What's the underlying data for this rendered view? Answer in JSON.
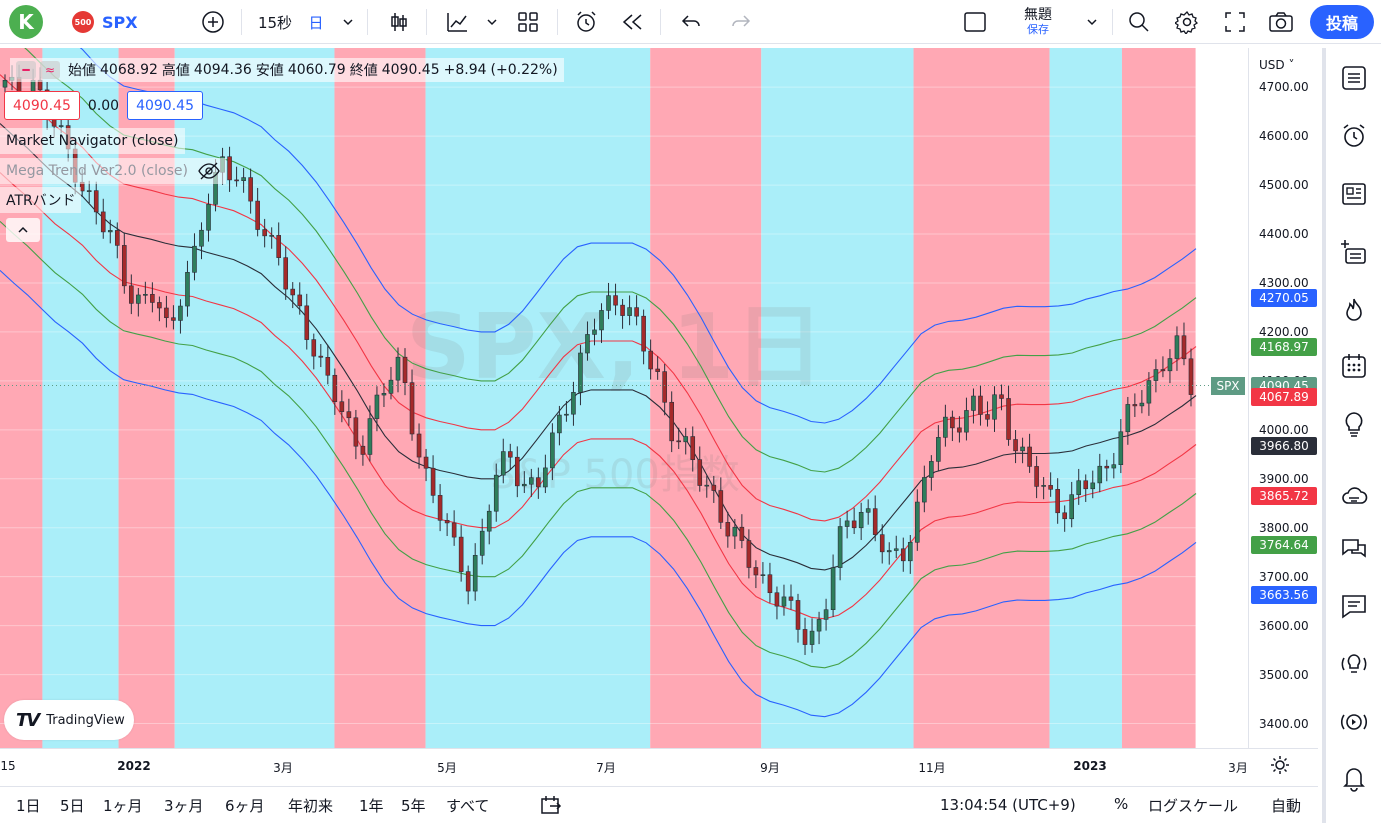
{
  "header": {
    "avatar_letter": "K",
    "symbol_badge": "500",
    "symbol": "SPX",
    "interval": "15秒",
    "chart_style_label": "日",
    "layout_name": "無題",
    "layout_save": "保存",
    "publish": "投稿"
  },
  "legend": {
    "open_label": "始値",
    "open": "4068.92",
    "high_label": "高値",
    "high": "4094.36",
    "low_label": "安値",
    "low": "4060.79",
    "close_label": "終値",
    "close": "4090.45",
    "change": "+8.94",
    "change_pct": "(+0.22%)"
  },
  "readout": {
    "bid": "4090.45",
    "spread": "0.00",
    "ask": "4090.45"
  },
  "indicators": {
    "ind1": "Market Navigator (close)",
    "ind2": "Mega Trend Ver2.0 (close)",
    "ind3": "ATRバンド"
  },
  "watermark": {
    "symbol": "SPX, 1日",
    "name": "S&P 500指数"
  },
  "logo": "TradingView",
  "price_axis": {
    "currency": "USD",
    "ticks": [
      "4700.00",
      "4600.00",
      "4500.00",
      "4400.00",
      "4300.00",
      "4200.00",
      "4100.00",
      "4000.00",
      "3900.00",
      "3800.00",
      "3700.00",
      "3600.00",
      "3500.00",
      "3400.00"
    ],
    "labels": [
      {
        "text": "4270.05",
        "color": "#2962ff",
        "value": 4270.05
      },
      {
        "text": "4168.97",
        "color": "#43a047",
        "value": 4168.97
      },
      {
        "text": "4090.45",
        "color": "#5e9b84",
        "value": 4090.45
      },
      {
        "text": "4067.89",
        "color": "#f23645",
        "value": 4067.89
      },
      {
        "text": "3966.80",
        "color": "#2a2e39",
        "value": 3966.8
      },
      {
        "text": "3865.72",
        "color": "#f23645",
        "value": 3865.72
      },
      {
        "text": "3764.64",
        "color": "#43a047",
        "value": 3764.64
      },
      {
        "text": "3663.56",
        "color": "#2962ff",
        "value": 3663.56
      }
    ],
    "symbol_tag": "SPX"
  },
  "time_axis": [
    "15",
    "2022",
    "3月",
    "5月",
    "7月",
    "9月",
    "11月",
    "2023",
    "3月"
  ],
  "bottom": {
    "ranges": [
      "1日",
      "5日",
      "1ヶ月",
      "3ヶ月",
      "6ヶ月",
      "年初来",
      "1年",
      "5年",
      "すべて"
    ],
    "clock": "13:04:54 (UTC+9)",
    "percent": "%",
    "log": "ログスケール",
    "auto": "自動"
  },
  "chart_data": {
    "type": "candlestick",
    "ylim": [
      3350,
      4780
    ],
    "background_zones": [
      {
        "from": 0.0,
        "to": 0.034,
        "color": "#ffa8b4"
      },
      {
        "from": 0.034,
        "to": 0.095,
        "color": "#aaeef9"
      },
      {
        "from": 0.095,
        "to": 0.14,
        "color": "#ffa8b4"
      },
      {
        "from": 0.14,
        "to": 0.268,
        "color": "#aaeef9"
      },
      {
        "from": 0.268,
        "to": 0.341,
        "color": "#ffa8b4"
      },
      {
        "from": 0.341,
        "to": 0.521,
        "color": "#aaeef9"
      },
      {
        "from": 0.521,
        "to": 0.61,
        "color": "#ffa8b4"
      },
      {
        "from": 0.61,
        "to": 0.732,
        "color": "#aaeef9"
      },
      {
        "from": 0.732,
        "to": 0.841,
        "color": "#ffa8b4"
      },
      {
        "from": 0.841,
        "to": 0.899,
        "color": "#aaeef9"
      },
      {
        "from": 0.899,
        "to": 0.958,
        "color": "#ffa8b4"
      }
    ],
    "close_path": [
      4700,
      4680,
      4720,
      4650,
      4600,
      4550,
      4480,
      4420,
      4380,
      4300,
      4250,
      4270,
      4200,
      4300,
      4350,
      4480,
      4560,
      4520,
      4450,
      4400,
      4380,
      4260,
      4200,
      4150,
      4100,
      4000,
      3950,
      4050,
      4100,
      4120,
      4000,
      3900,
      3820,
      3750,
      3700,
      3780,
      3900,
      3950,
      3900,
      3870,
      3960,
      4050,
      4120,
      4200,
      4250,
      4280,
      4230,
      4150,
      4100,
      4000,
      3950,
      3900,
      3870,
      3800,
      3750,
      3720,
      3680,
      3650,
      3600,
      3580,
      3620,
      3750,
      3820,
      3850,
      3780,
      3720,
      3760,
      3850,
      3950,
      4000,
      4030,
      4050,
      4020,
      4070,
      3980,
      3920,
      3880,
      3860,
      3840,
      3880,
      3900,
      3940,
      4000,
      4050,
      4100,
      4150,
      4160,
      4090
    ]
  }
}
